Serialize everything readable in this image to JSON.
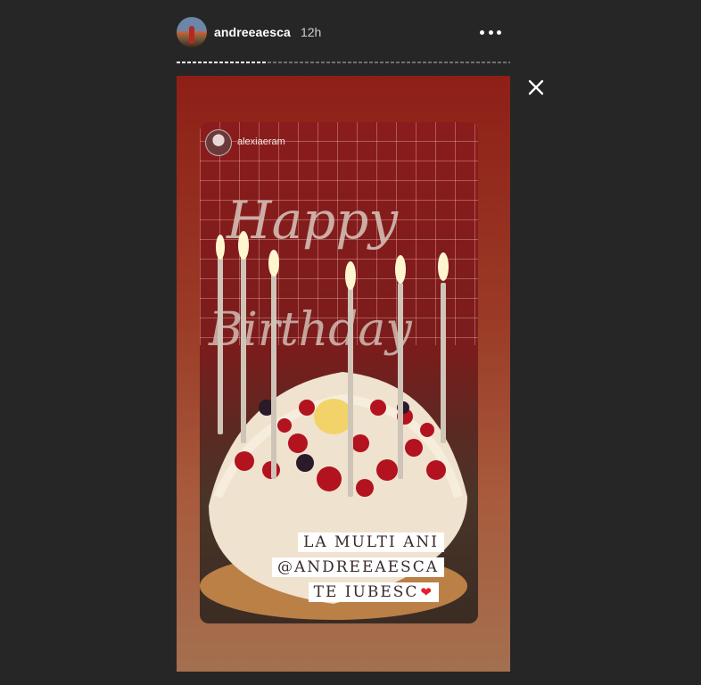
{
  "header": {
    "username": "andreeaesca",
    "time": "12h",
    "more_icon": "more-horizontal-icon"
  },
  "story": {
    "progress": 0.27,
    "close_icon": "close-icon",
    "mentioned_user": "alexiaeram",
    "caption_lines": [
      "LA MULTI ANI",
      "@ANDREEAESCA",
      "TE IUBESC"
    ],
    "heart_icon": "red-heart-icon",
    "colors": {
      "background": "#262626",
      "story_top": "#8e1f17",
      "story_bottom": "#a4704f",
      "heart": "#e3202a"
    }
  }
}
